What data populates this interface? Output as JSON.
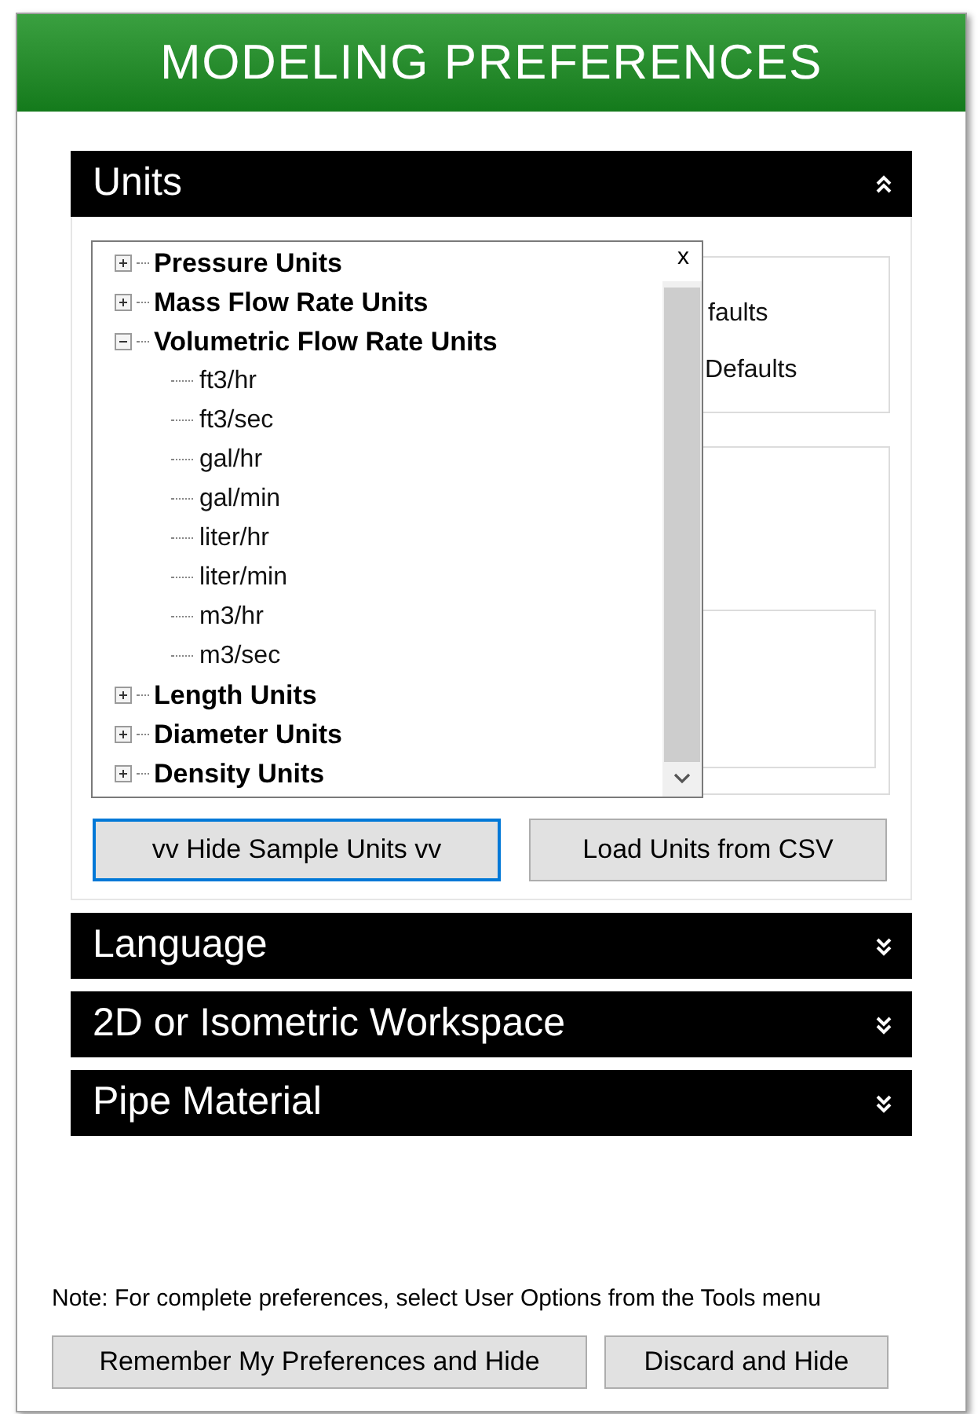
{
  "window": {
    "title": "MODELING PREFERENCES"
  },
  "sections": [
    {
      "title": "Units",
      "expanded": true
    },
    {
      "title": "Language",
      "expanded": false
    },
    {
      "title": "2D or Isometric Workspace",
      "expanded": false
    },
    {
      "title": "Pipe Material",
      "expanded": false
    }
  ],
  "units_panel": {
    "behind_texts": [
      "faults",
      "Defaults"
    ],
    "tree": [
      {
        "label": "Pressure Units",
        "expanded": false
      },
      {
        "label": "Mass Flow Rate Units",
        "expanded": false
      },
      {
        "label": "Volumetric Flow Rate Units",
        "expanded": true,
        "children": [
          {
            "label": "ft3/hr"
          },
          {
            "label": "ft3/sec"
          },
          {
            "label": "gal/hr"
          },
          {
            "label": "gal/min"
          },
          {
            "label": "liter/hr"
          },
          {
            "label": "liter/min"
          },
          {
            "label": "m3/hr"
          },
          {
            "label": "m3/sec"
          }
        ]
      },
      {
        "label": "Length Units",
        "expanded": false
      },
      {
        "label": "Diameter Units",
        "expanded": false
      },
      {
        "label": "Density Units",
        "expanded": false
      }
    ],
    "tree_close": "x",
    "buttons": [
      {
        "label": "vv Hide Sample Units vv",
        "focused": true
      },
      {
        "label": "Load Units from CSV",
        "focused": false
      }
    ]
  },
  "note": "Note: For complete preferences, select User Options from the Tools menu",
  "footer_buttons": [
    "Remember My Preferences and Hide",
    "Discard and Hide"
  ]
}
